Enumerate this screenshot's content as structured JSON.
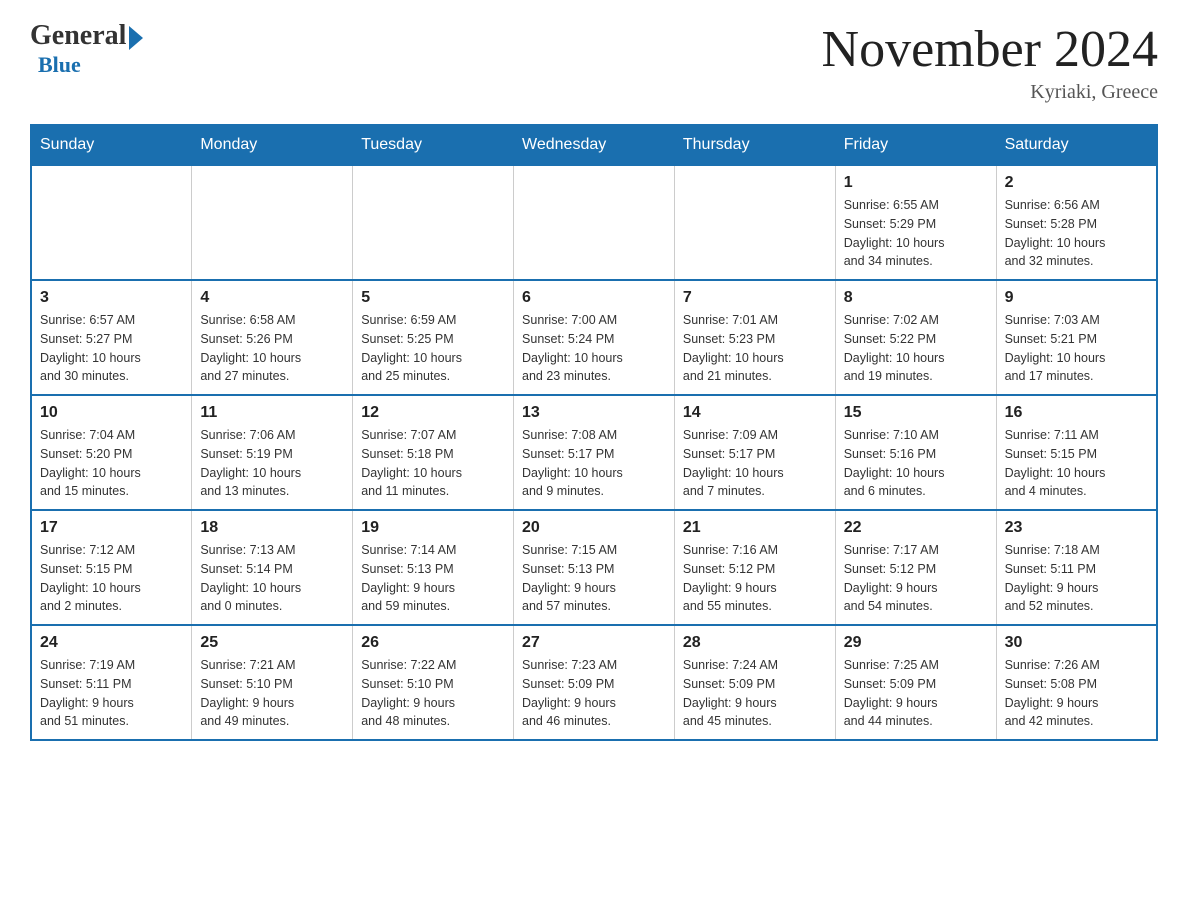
{
  "logo": {
    "general": "General",
    "blue": "Blue"
  },
  "header": {
    "month_year": "November 2024",
    "location": "Kyriaki, Greece"
  },
  "days_of_week": [
    "Sunday",
    "Monday",
    "Tuesday",
    "Wednesday",
    "Thursday",
    "Friday",
    "Saturday"
  ],
  "weeks": [
    [
      {
        "day": "",
        "info": ""
      },
      {
        "day": "",
        "info": ""
      },
      {
        "day": "",
        "info": ""
      },
      {
        "day": "",
        "info": ""
      },
      {
        "day": "",
        "info": ""
      },
      {
        "day": "1",
        "info": "Sunrise: 6:55 AM\nSunset: 5:29 PM\nDaylight: 10 hours\nand 34 minutes."
      },
      {
        "day": "2",
        "info": "Sunrise: 6:56 AM\nSunset: 5:28 PM\nDaylight: 10 hours\nand 32 minutes."
      }
    ],
    [
      {
        "day": "3",
        "info": "Sunrise: 6:57 AM\nSunset: 5:27 PM\nDaylight: 10 hours\nand 30 minutes."
      },
      {
        "day": "4",
        "info": "Sunrise: 6:58 AM\nSunset: 5:26 PM\nDaylight: 10 hours\nand 27 minutes."
      },
      {
        "day": "5",
        "info": "Sunrise: 6:59 AM\nSunset: 5:25 PM\nDaylight: 10 hours\nand 25 minutes."
      },
      {
        "day": "6",
        "info": "Sunrise: 7:00 AM\nSunset: 5:24 PM\nDaylight: 10 hours\nand 23 minutes."
      },
      {
        "day": "7",
        "info": "Sunrise: 7:01 AM\nSunset: 5:23 PM\nDaylight: 10 hours\nand 21 minutes."
      },
      {
        "day": "8",
        "info": "Sunrise: 7:02 AM\nSunset: 5:22 PM\nDaylight: 10 hours\nand 19 minutes."
      },
      {
        "day": "9",
        "info": "Sunrise: 7:03 AM\nSunset: 5:21 PM\nDaylight: 10 hours\nand 17 minutes."
      }
    ],
    [
      {
        "day": "10",
        "info": "Sunrise: 7:04 AM\nSunset: 5:20 PM\nDaylight: 10 hours\nand 15 minutes."
      },
      {
        "day": "11",
        "info": "Sunrise: 7:06 AM\nSunset: 5:19 PM\nDaylight: 10 hours\nand 13 minutes."
      },
      {
        "day": "12",
        "info": "Sunrise: 7:07 AM\nSunset: 5:18 PM\nDaylight: 10 hours\nand 11 minutes."
      },
      {
        "day": "13",
        "info": "Sunrise: 7:08 AM\nSunset: 5:17 PM\nDaylight: 10 hours\nand 9 minutes."
      },
      {
        "day": "14",
        "info": "Sunrise: 7:09 AM\nSunset: 5:17 PM\nDaylight: 10 hours\nand 7 minutes."
      },
      {
        "day": "15",
        "info": "Sunrise: 7:10 AM\nSunset: 5:16 PM\nDaylight: 10 hours\nand 6 minutes."
      },
      {
        "day": "16",
        "info": "Sunrise: 7:11 AM\nSunset: 5:15 PM\nDaylight: 10 hours\nand 4 minutes."
      }
    ],
    [
      {
        "day": "17",
        "info": "Sunrise: 7:12 AM\nSunset: 5:15 PM\nDaylight: 10 hours\nand 2 minutes."
      },
      {
        "day": "18",
        "info": "Sunrise: 7:13 AM\nSunset: 5:14 PM\nDaylight: 10 hours\nand 0 minutes."
      },
      {
        "day": "19",
        "info": "Sunrise: 7:14 AM\nSunset: 5:13 PM\nDaylight: 9 hours\nand 59 minutes."
      },
      {
        "day": "20",
        "info": "Sunrise: 7:15 AM\nSunset: 5:13 PM\nDaylight: 9 hours\nand 57 minutes."
      },
      {
        "day": "21",
        "info": "Sunrise: 7:16 AM\nSunset: 5:12 PM\nDaylight: 9 hours\nand 55 minutes."
      },
      {
        "day": "22",
        "info": "Sunrise: 7:17 AM\nSunset: 5:12 PM\nDaylight: 9 hours\nand 54 minutes."
      },
      {
        "day": "23",
        "info": "Sunrise: 7:18 AM\nSunset: 5:11 PM\nDaylight: 9 hours\nand 52 minutes."
      }
    ],
    [
      {
        "day": "24",
        "info": "Sunrise: 7:19 AM\nSunset: 5:11 PM\nDaylight: 9 hours\nand 51 minutes."
      },
      {
        "day": "25",
        "info": "Sunrise: 7:21 AM\nSunset: 5:10 PM\nDaylight: 9 hours\nand 49 minutes."
      },
      {
        "day": "26",
        "info": "Sunrise: 7:22 AM\nSunset: 5:10 PM\nDaylight: 9 hours\nand 48 minutes."
      },
      {
        "day": "27",
        "info": "Sunrise: 7:23 AM\nSunset: 5:09 PM\nDaylight: 9 hours\nand 46 minutes."
      },
      {
        "day": "28",
        "info": "Sunrise: 7:24 AM\nSunset: 5:09 PM\nDaylight: 9 hours\nand 45 minutes."
      },
      {
        "day": "29",
        "info": "Sunrise: 7:25 AM\nSunset: 5:09 PM\nDaylight: 9 hours\nand 44 minutes."
      },
      {
        "day": "30",
        "info": "Sunrise: 7:26 AM\nSunset: 5:08 PM\nDaylight: 9 hours\nand 42 minutes."
      }
    ]
  ]
}
